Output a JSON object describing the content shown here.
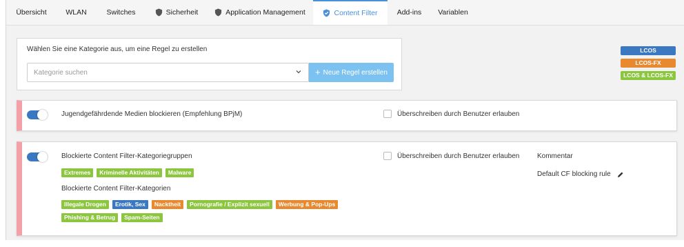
{
  "tabs": [
    {
      "label": "Übersicht",
      "icon": ""
    },
    {
      "label": "WLAN",
      "icon": ""
    },
    {
      "label": "Switches",
      "icon": ""
    },
    {
      "label": "Sicherheit",
      "icon": "shield-icon"
    },
    {
      "label": "Application Management",
      "icon": "shield-icon"
    },
    {
      "label": "Content Filter",
      "icon": "shield-check-icon",
      "active": true
    },
    {
      "label": "Add-ins",
      "icon": ""
    },
    {
      "label": "Variablen",
      "icon": ""
    }
  ],
  "create": {
    "title": "Wählen Sie eine Kategorie aus, um eine Regel zu erstellen",
    "search_placeholder": "Kategorie suchen",
    "new_rule_label": "Neue Regel erstellen"
  },
  "legend": [
    {
      "label": "LCOS",
      "color": "#3a78c2"
    },
    {
      "label": "LCOS-FX",
      "color": "#e8892f"
    },
    {
      "label": "LCOS & LCOS-FX",
      "color": "#8cc63f"
    }
  ],
  "rule1": {
    "enabled": true,
    "title": "Jugendgefährdende Medien blockieren (Empfehlung BPjM)",
    "override_label": "Überschreiben durch Benutzer erlauben"
  },
  "rule2": {
    "enabled": true,
    "groups_heading": "Blockierte Content Filter-Kategoriegruppen",
    "groups": [
      {
        "label": "Extremes",
        "color": "#8cc63f"
      },
      {
        "label": "Kriminelle Aktivitäten",
        "color": "#8cc63f"
      },
      {
        "label": "Malware",
        "color": "#8cc63f"
      }
    ],
    "categories_heading": "Blockierte Content Filter-Kategorien",
    "categories": [
      {
        "label": "Illegale Drogen",
        "color": "#8cc63f"
      },
      {
        "label": "Erotik, Sex",
        "color": "#3a78c2"
      },
      {
        "label": "Nacktheit",
        "color": "#e8892f"
      },
      {
        "label": "Pornografie / Explizit sexuell",
        "color": "#8cc63f"
      },
      {
        "label": "Werbung & Pop-Ups",
        "color": "#e8892f"
      },
      {
        "label": "Phishing & Betrug",
        "color": "#8cc63f"
      },
      {
        "label": "Spam-Seiten",
        "color": "#8cc63f"
      }
    ],
    "override_label": "Überschreiben durch Benutzer erlauben",
    "comment_heading": "Kommentar",
    "comment": "Default CF blocking rule"
  }
}
